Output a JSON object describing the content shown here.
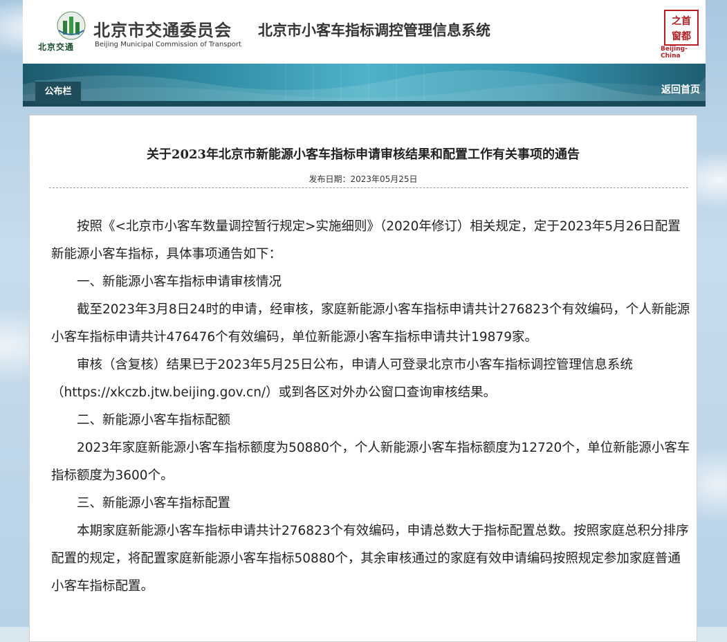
{
  "header": {
    "logo_caption": "北京交通",
    "commission_cn": "北京市交通委员会",
    "commission_en": "Beijing Municipal Commission of Transport",
    "system_title": "北京市小客车指标调控管理信息系统",
    "seal_chars": [
      "首",
      "都",
      "之",
      "窗"
    ],
    "seal_en": "Beijing-China"
  },
  "nav": {
    "board_tab": "公布栏",
    "back_home": "返回首页"
  },
  "notice": {
    "title": "关于2023年北京市新能源小客车指标申请审核结果和配置工作有关事项的通告",
    "date": "发布日期：2023年05月25日",
    "paragraphs": [
      "按照《<北京市小客车数量调控暂行规定>实施细则》（2020年修订）相关规定，定于2023年5月26日配置新能源小客车指标，具体事项通告如下：",
      "一、新能源小客车指标申请审核情况",
      "截至2023年3月8日24时的申请，经审核，家庭新能源小客车指标申请共计276823个有效编码，个人新能源小客车指标申请共计476476个有效编码，单位新能源小客车指标申请共计19879家。",
      "审核（含复核）结果已于2023年5月25日公布，申请人可登录北京市小客车指标调控管理信息系统（https://xkczb.jtw.beijing.gov.cn/）或到各区对外办公窗口查询审核结果。",
      "二、新能源小客车指标配额",
      "2023年家庭新能源小客车指标额度为50880个，个人新能源小客车指标额度为12720个，单位新能源小客车指标额度为3600个。",
      "三、新能源小客车指标配置",
      "本期家庭新能源小客车指标申请共计276823个有效编码，申请总数大于指标配置总数。按照家庭总积分排序配置的规定，将配置家庭新能源小客车指标50880个，其余审核通过的家庭有效申请编码按照规定参加家庭普通小客车指标配置。"
    ]
  },
  "colors": {
    "banner": "#2d88a0",
    "tab": "#1f4d5c",
    "seal": "#b81d24"
  }
}
